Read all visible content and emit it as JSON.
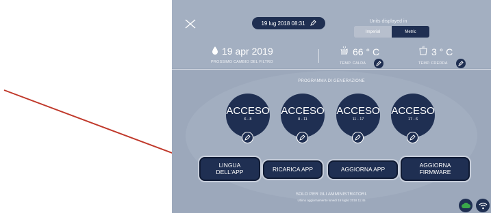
{
  "header": {
    "date_time": "19 lug 2018 08:31",
    "units_title": "Units displayed in",
    "units": {
      "imperial": "Imperial",
      "metric": "Metric",
      "selected": "Metric"
    }
  },
  "status": {
    "filter_date": "19 apr 2019",
    "filter_label": "PROSSIMO CAMBIO DEL FILTRO",
    "hot_temp": "66 ° C",
    "hot_label": "TEMP. CALDA",
    "cold_temp": "3 ° C",
    "cold_label": "TEMP. FREDDA"
  },
  "program": {
    "title": "PROGRAMMA DI GENERAZIONE",
    "slots": [
      {
        "state": "ACCESO",
        "hours": "6 - 8"
      },
      {
        "state": "ACCESO",
        "hours": "8 - 11"
      },
      {
        "state": "ACCESO",
        "hours": "11 - 17"
      },
      {
        "state": "ACCESO",
        "hours": "17 - 6"
      }
    ]
  },
  "buttons": {
    "language": "LINGUA\nDELL'APP",
    "reload": "RICARICA APP",
    "update_app": "AGGIORNA APP",
    "update_firmware": "AGGIORNA\nFIRMWARE"
  },
  "footer": {
    "admin_only": "SOLO PER GLI AMMINISTRATORI.",
    "last_update": "Ultimo aggiornamento lunedì 16 luglio 2018 11:45"
  },
  "colors": {
    "panel_bg": "#9ca8bb",
    "dark_navy": "#1f2f52",
    "annotation_arrow": "#c0392b",
    "cloud_icon": "#3aa84a"
  }
}
